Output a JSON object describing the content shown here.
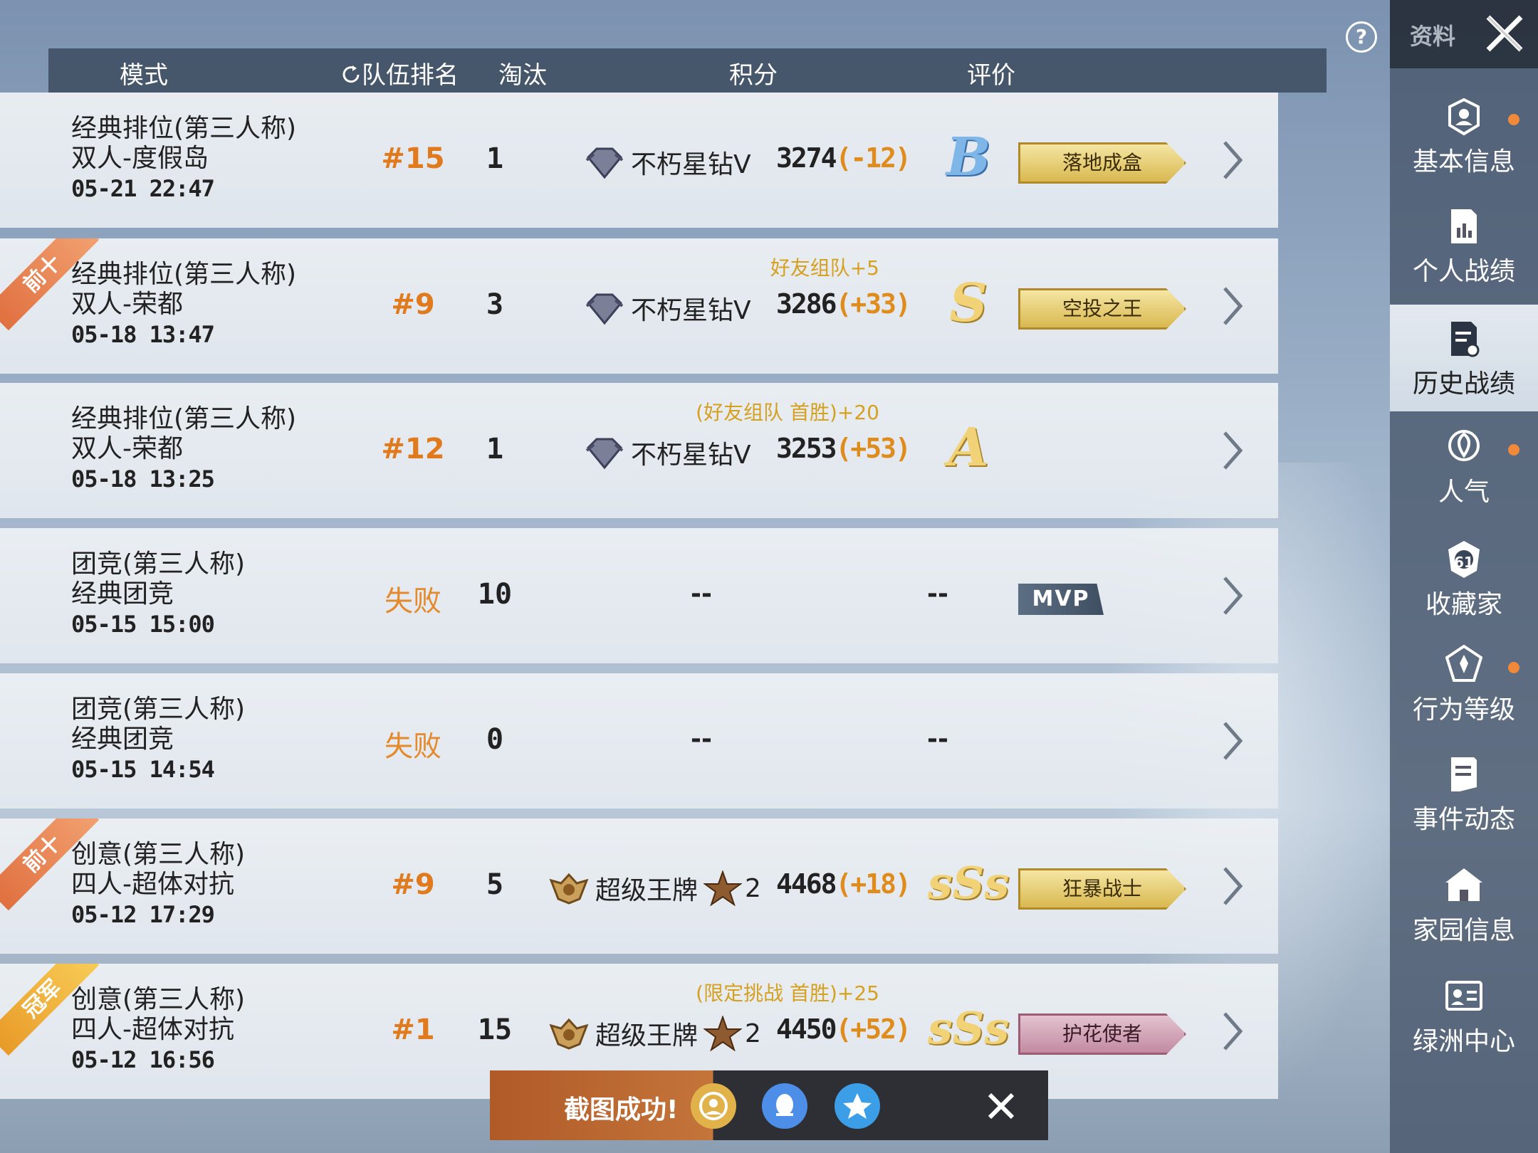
{
  "help_label": "?",
  "header": {
    "mode": "模式",
    "team_rank": "队伍排名",
    "kills": "淘汰",
    "score": "积分",
    "rating": "评价"
  },
  "rows": [
    {
      "line1": "经典排位(第三人称)",
      "line2": "双人-度假岛",
      "date": "05-21 22:47",
      "rank": "#15",
      "kills": "1",
      "tier": "不朽星钻Ⅴ",
      "score": "3274",
      "delta": "(-12)",
      "grade": "B",
      "badge": "落地成盒",
      "ribbon": "",
      "bonus": ""
    },
    {
      "line1": "经典排位(第三人称)",
      "line2": "双人-荣都",
      "date": "05-18 13:47",
      "rank": "#9",
      "kills": "3",
      "tier": "不朽星钻Ⅴ",
      "score": "3286",
      "delta": "(+33)",
      "grade": "S",
      "badge": "空投之王",
      "ribbon": "前十",
      "bonus": "好友组队+5"
    },
    {
      "line1": "经典排位(第三人称)",
      "line2": "双人-荣都",
      "date": "05-18 13:25",
      "rank": "#12",
      "kills": "1",
      "tier": "不朽星钻Ⅴ",
      "score": "3253",
      "delta": "(+53)",
      "grade": "A",
      "badge": "",
      "ribbon": "",
      "bonus": "(好友组队 首胜)+20"
    },
    {
      "line1": "团竞(第三人称)",
      "line2": "经典团竞",
      "date": "05-15 15:00",
      "rank": "失败",
      "kills": "10",
      "score_dash": "--",
      "grade_dash": "--",
      "mvp": "MVP"
    },
    {
      "line1": "团竞(第三人称)",
      "line2": "经典团竞",
      "date": "05-15 14:54",
      "rank": "失败",
      "kills": "0",
      "score_dash": "--",
      "grade_dash": "--"
    },
    {
      "line1": "创意(第三人称)",
      "line2": "四人-超体对抗",
      "date": "05-12 17:29",
      "rank": "#9",
      "kills": "5",
      "tier": "超级王牌",
      "tier_level": "2",
      "score": "4468",
      "delta": "(+18)",
      "grade": "sSs",
      "badge": "狂暴战士",
      "ribbon": "前十",
      "bonus": ""
    },
    {
      "line1": "创意(第三人称)",
      "line2": "四人-超体对抗",
      "date": "05-12 16:56",
      "rank": "#1",
      "kills": "15",
      "tier": "超级王牌",
      "tier_level": "2",
      "score": "4450",
      "delta": "(+52)",
      "grade": "sSs",
      "badge": "护花使者",
      "ribbon": "冠军",
      "bonus": "(限定挑战 首胜)+25"
    }
  ],
  "sidebar": {
    "title": "资料",
    "items": [
      {
        "label": "基本信息",
        "icon": "avatar-shield-icon",
        "dot": true
      },
      {
        "label": "个人战绩",
        "icon": "chart-document-icon",
        "dot": false
      },
      {
        "label": "历史战绩",
        "icon": "history-document-icon",
        "dot": false,
        "active": true
      },
      {
        "label": "人气",
        "icon": "rose-icon",
        "dot": true
      },
      {
        "label": "收藏家",
        "icon": "collector-badge-icon",
        "dot": false
      },
      {
        "label": "行为等级",
        "icon": "behavior-shield-icon",
        "dot": true
      },
      {
        "label": "事件动态",
        "icon": "event-note-icon",
        "dot": false
      },
      {
        "label": "家园信息",
        "icon": "home-icon",
        "dot": false
      },
      {
        "label": "绿洲中心",
        "icon": "id-card-icon",
        "dot": false
      }
    ],
    "collector_number": "61"
  },
  "toast": {
    "text": "截图成功!",
    "share_icons": [
      "camera-share-icon",
      "qq-icon",
      "qzone-icon"
    ]
  },
  "colors": {
    "accent": "#e07a1c",
    "bonus": "#d6a020",
    "notify_dot": "#f08a3a"
  }
}
